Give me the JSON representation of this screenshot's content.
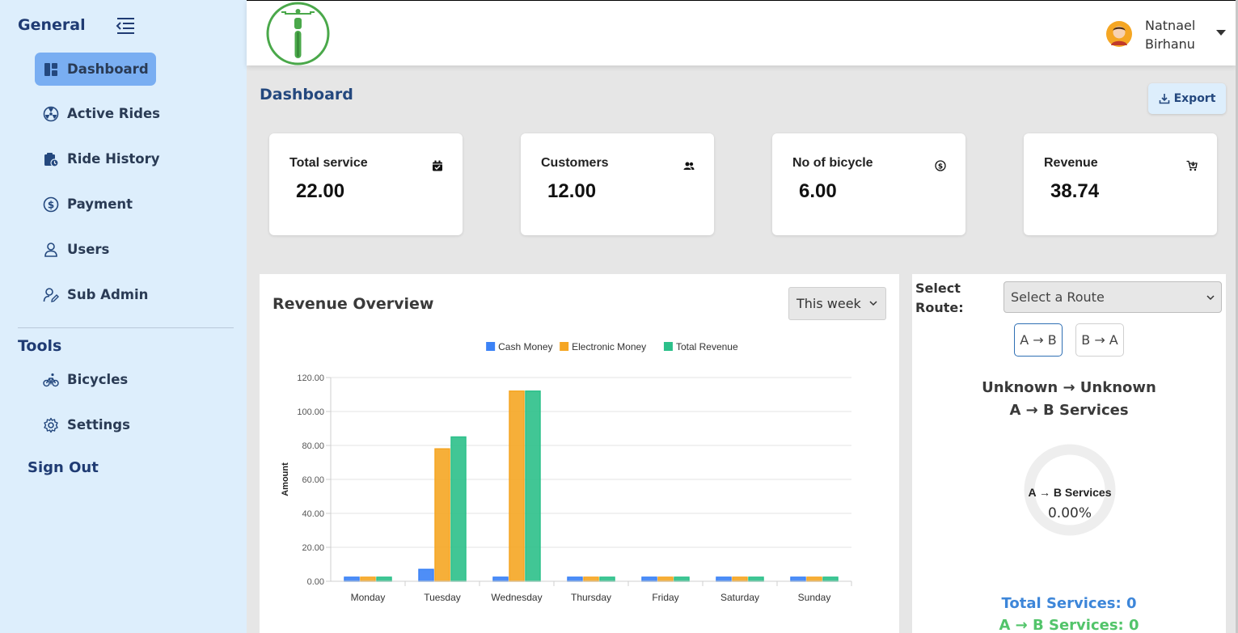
{
  "sidebar": {
    "general_label": "General",
    "tools_label": "Tools",
    "general_items": [
      {
        "label": "Dashboard",
        "icon": "dashboard-icon"
      },
      {
        "label": "Active Rides",
        "icon": "radiation-icon"
      },
      {
        "label": "Ride History",
        "icon": "clipboard-clock-icon"
      },
      {
        "label": "Payment",
        "icon": "dollar-circle-icon"
      },
      {
        "label": "Users",
        "icon": "user-icon"
      },
      {
        "label": "Sub Admin",
        "icon": "user-edit-icon"
      }
    ],
    "tools_items": [
      {
        "label": "Bicycles",
        "icon": "bicycle-icon"
      },
      {
        "label": "Settings",
        "icon": "gear-icon"
      }
    ],
    "signout_label": "Sign Out",
    "colors": {
      "background": "#ddeefc",
      "active": "#79aef2",
      "heading": "#1f3b73"
    }
  },
  "header": {
    "user_first": "Natnael",
    "user_last": "Birhanu",
    "logo_icon": "bicycle-logo-icon",
    "avatar_icon": "user-avatar-icon"
  },
  "page": {
    "title": "Dashboard",
    "export_label": "Export"
  },
  "stats": [
    {
      "label": "Total service",
      "value": "22.00",
      "icon": "calendar-check-icon"
    },
    {
      "label": "Customers",
      "value": "12.00",
      "icon": "users-icon"
    },
    {
      "label": "No of bicycle",
      "value": "6.00",
      "icon": "dollar-circle-icon"
    },
    {
      "label": "Revenue",
      "value": "38.74",
      "icon": "cart-icon"
    }
  ],
  "revenue": {
    "title": "Revenue Overview",
    "period": "This week"
  },
  "chart_data": {
    "type": "bar",
    "categories": [
      "Monday",
      "Tuesday",
      "Wednesday",
      "Thursday",
      "Friday",
      "Saturday",
      "Sunday"
    ],
    "series": [
      {
        "name": "Cash Money",
        "color": "#3b82f6",
        "values": [
          0,
          7,
          0,
          0,
          0,
          0,
          0
        ]
      },
      {
        "name": "Electronic Money",
        "color": "#f5a623",
        "values": [
          0,
          78,
          112,
          0,
          0,
          0,
          0
        ]
      },
      {
        "name": "Total Revenue",
        "color": "#2cc08a",
        "values": [
          0,
          85,
          112,
          0,
          0,
          0,
          0
        ]
      }
    ],
    "ylabel": "Amount",
    "ylim": [
      0,
      120
    ],
    "yticks": [
      "0.00",
      "20.00",
      "40.00",
      "60.00",
      "80.00",
      "100.00",
      "120.00"
    ],
    "legend": "top",
    "grid": true
  },
  "route": {
    "label": "Select Route:",
    "select_placeholder": "Select a Route",
    "ab_button": "A → B",
    "ba_button": "B → A",
    "heading_line1": "Unknown → Unknown",
    "heading_line2": "A → B Services",
    "donut_title": "A → B Services",
    "donut_value": "0.00%",
    "donut_percent": 0,
    "total_services": "Total Services: 0",
    "ab_services": "A → B Services: 0"
  }
}
